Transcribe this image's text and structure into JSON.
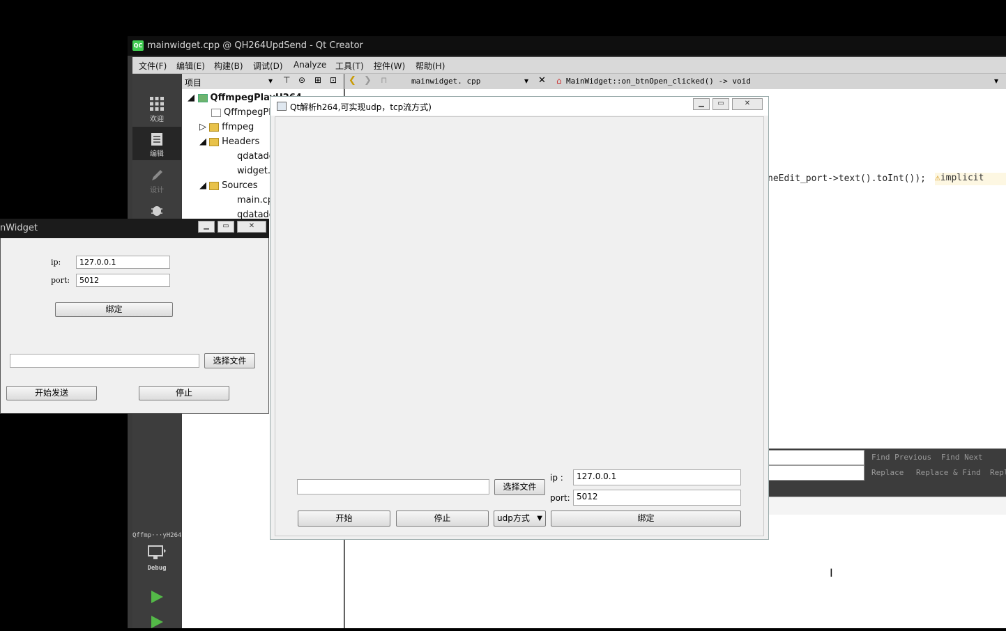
{
  "qtcreator": {
    "title": "mainwidget.cpp @ QH264UpdSend - Qt Creator",
    "logo": "QC",
    "menu": [
      "文件(F)",
      "编辑(E)",
      "构建(B)",
      "调试(D)",
      "Analyze",
      "工具(T)",
      "控件(W)",
      "帮助(H)"
    ],
    "modes": {
      "welcome": "欢迎",
      "edit": "编辑",
      "design": "设计",
      "debug": "Debug"
    },
    "kit_label": "Qffmp···yH264",
    "kit_build": "Debug",
    "project_panel_label": "项目",
    "tree": [
      {
        "label": "QffmpegPlayH264",
        "level": 0,
        "bold": true
      },
      {
        "label": "QffmpegPla",
        "level": 1
      },
      {
        "label": "ffmpeg",
        "level": 1
      },
      {
        "label": "Headers",
        "level": 1
      },
      {
        "label": "qdatade",
        "level": 2
      },
      {
        "label": "widget.h",
        "level": 2
      },
      {
        "label": "Sources",
        "level": 1
      },
      {
        "label": "main.cpp",
        "level": 2
      },
      {
        "label": "qdatade",
        "level": 2
      }
    ],
    "editor_file": "mainwidget. cpp",
    "editor_function": "MainWidget::on_btnOpen_clicked() -> void",
    "code_line": "neEdit_port->text().toInt());",
    "code_warning": "implicit",
    "find": {
      "find_previous": "Find Previous",
      "find_next": "Find Next",
      "replace": "Replace",
      "replace_find": "Replace & Find",
      "replace_all": "Repl"
    }
  },
  "mainwidget": {
    "title": "nWidget",
    "ip_label": "ip:",
    "ip_value": "127.0.0.1",
    "port_label": "port:",
    "port_value": "5012",
    "bind_button": "绑定",
    "file_path": "",
    "choose_file_button": "选择文件",
    "start_send_button": "开始发送",
    "stop_button": "停止"
  },
  "dialog": {
    "title": "Qt解析h264,可实现udp，tcp流方式)",
    "file_path": "",
    "choose_file_button": "选择文件",
    "ip_label": "ip :",
    "ip_value": "127.0.0.1",
    "port_label": "port:",
    "port_value": "5012",
    "start_button": "开始",
    "stop_button": "停止",
    "mode_select": "udp方式",
    "bind_button": "绑定"
  }
}
